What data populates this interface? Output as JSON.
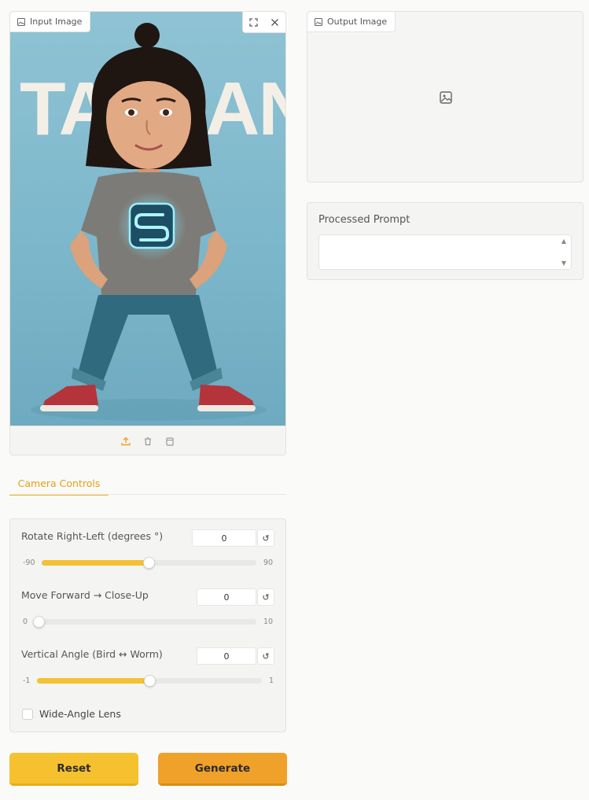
{
  "input_panel": {
    "label": "Input Image",
    "icons": [
      "image-icon",
      "fullscreen-icon",
      "close-icon",
      "upload-icon",
      "eraser-icon",
      "clipboard-icon"
    ],
    "poster_text": "TA      AN"
  },
  "output_panel": {
    "label": "Output Image",
    "placeholder_icon": "image-placeholder-icon"
  },
  "prompt_panel": {
    "label": "Processed Prompt",
    "value": ""
  },
  "tabs": [
    {
      "label": "Camera Controls",
      "active": true
    }
  ],
  "controls": {
    "rotate": {
      "label": "Rotate Right-Left (degrees °)",
      "value": "0",
      "min_label": "-90",
      "max_label": "90",
      "fraction": 0.5
    },
    "forward": {
      "label": "Move Forward → Close-Up",
      "value": "0",
      "min_label": "0",
      "max_label": "10",
      "fraction": 0.0
    },
    "vertical": {
      "label": "Vertical Angle (Bird ↔ Worm)",
      "value": "0",
      "min_label": "-1",
      "max_label": "1",
      "fraction": 0.5
    },
    "reset_icon": "↺",
    "wide_angle": {
      "label": "Wide-Angle Lens",
      "checked": false
    }
  },
  "buttons": {
    "reset": "Reset",
    "generate": "Generate"
  },
  "colors": {
    "accent": "#f0b323",
    "slider_fill": "#f3c133",
    "reset_button": "#f6c12e",
    "generate_button": "#f0a12a"
  }
}
